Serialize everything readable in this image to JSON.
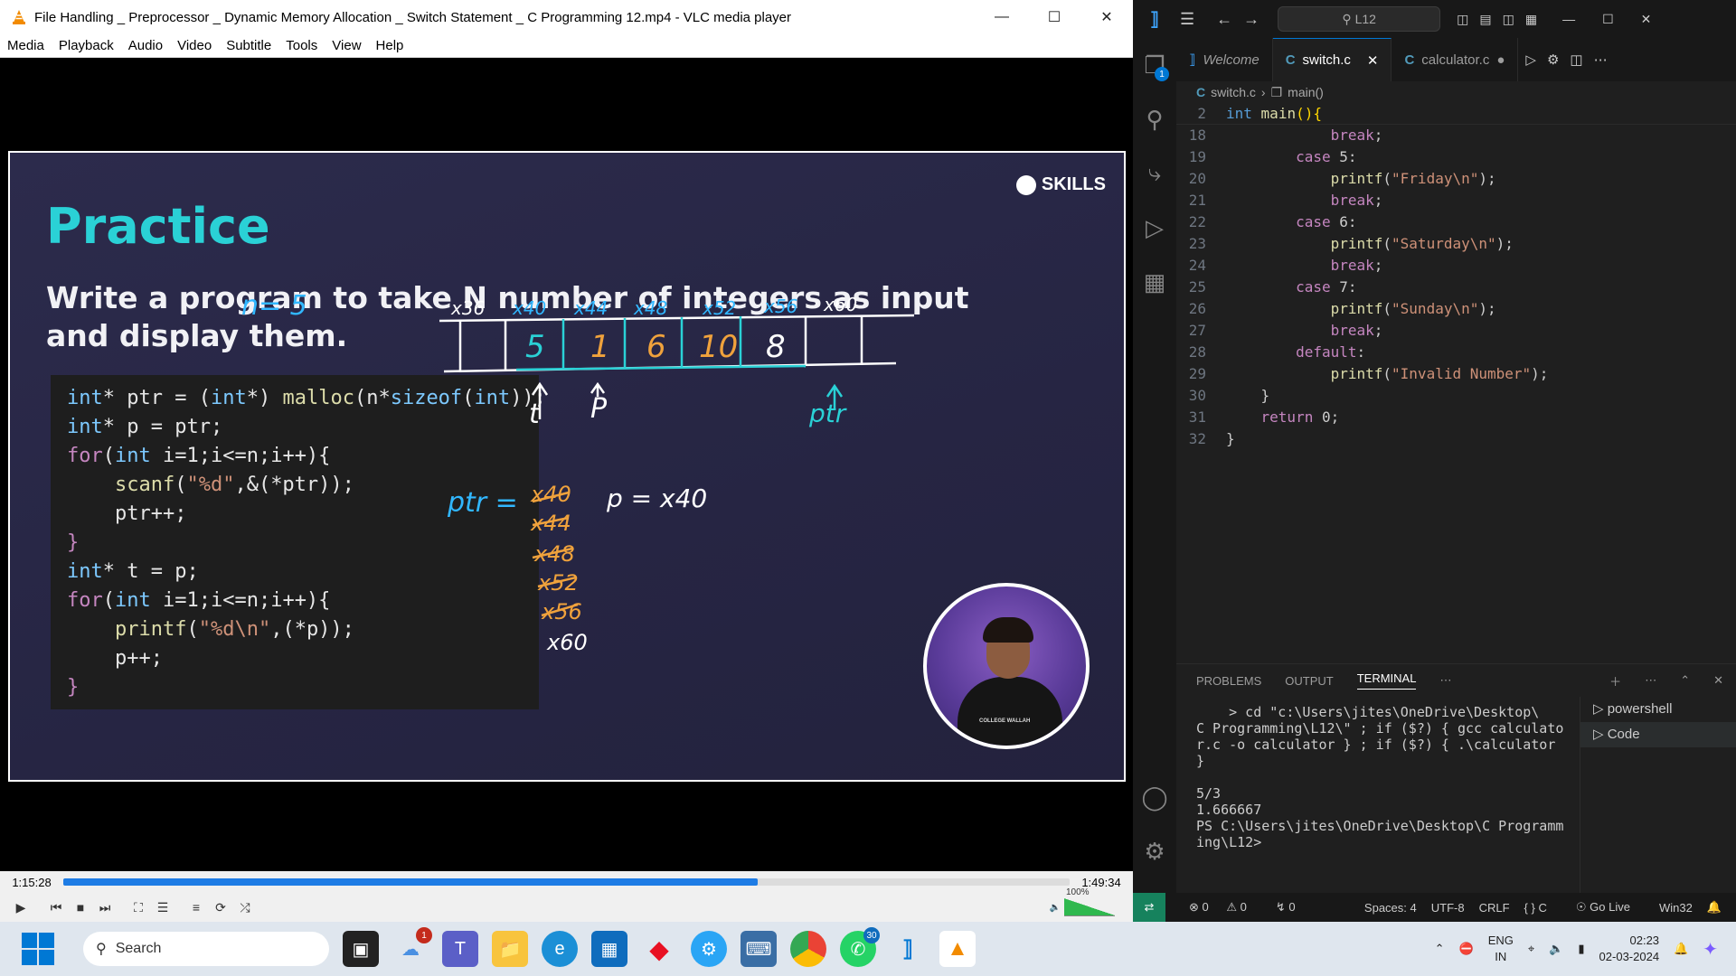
{
  "vlc": {
    "title": "File Handling _ Preprocessor _ Dynamic Memory Allocation _ Switch Statement _ C Programming 12.mp4 - VLC media player",
    "menu": [
      "Media",
      "Playback",
      "Audio",
      "Video",
      "Subtitle",
      "Tools",
      "View",
      "Help"
    ],
    "time_elapsed": "1:15:28",
    "time_total": "1:49:34",
    "progress_fraction": 0.69,
    "volume": "100%"
  },
  "slide": {
    "brand": "SKILLS",
    "heading": "Practice",
    "question": "Write a program to take N number of integers as input and display them.",
    "code": [
      "int* ptr = (int*) malloc(n*sizeof(int));",
      "int* p = ptr;",
      "for(int i=1;i<=n;i++){",
      "    scanf(\"%d\",&(*ptr));",
      "    ptr++;",
      "}",
      "int* t = p;",
      "for(int i=1;i<=n;i++){",
      "    printf(\"%d\\n\",(*p));",
      "    p++;",
      "}"
    ],
    "handwriting": {
      "n_equals": "n= 5",
      "addresses": [
        "x36",
        "x40",
        "x44",
        "x48",
        "x52",
        "x56",
        "x60"
      ],
      "cells": [
        "5",
        "1",
        "6",
        "10",
        "8"
      ],
      "arrow_t": "t",
      "arrow_p": "P",
      "arrow_ptr": "ptr",
      "ptr_label": "ptr =",
      "ptr_history": [
        "x40",
        "x44",
        "x48",
        "x52",
        "x56",
        "x60"
      ],
      "p_equals": "p = x40"
    },
    "presenter_badge": "COLLEGE WALLAH"
  },
  "vscode": {
    "search": "L12",
    "tabs": [
      {
        "label": "Welcome",
        "icon": "vscode-icon"
      },
      {
        "label": "switch.c",
        "icon": "c-icon"
      },
      {
        "label": "calculator.c",
        "icon": "c-icon"
      }
    ],
    "explorer_badge": "1",
    "breadcrumb": {
      "file": "switch.c",
      "symbol": "main()"
    },
    "sticky_line": {
      "num": "2",
      "text": "int main(){"
    },
    "lines": [
      {
        "num": "18",
        "text": "            break;"
      },
      {
        "num": "19",
        "text": "        case 5:"
      },
      {
        "num": "20",
        "text": "            printf(\"Friday\\n\");"
      },
      {
        "num": "21",
        "text": "            break;"
      },
      {
        "num": "22",
        "text": "        case 6:"
      },
      {
        "num": "23",
        "text": "            printf(\"Saturday\\n\");"
      },
      {
        "num": "24",
        "text": "            break;"
      },
      {
        "num": "25",
        "text": "        case 7:"
      },
      {
        "num": "26",
        "text": "            printf(\"Sunday\\n\");"
      },
      {
        "num": "27",
        "text": "            break;"
      },
      {
        "num": "28",
        "text": "        default:"
      },
      {
        "num": "29",
        "text": "            printf(\"Invalid Number\");"
      },
      {
        "num": "30",
        "text": "    }"
      },
      {
        "num": "31",
        "text": "    return 0;"
      },
      {
        "num": "32",
        "text": "}"
      }
    ],
    "panel_tabs": [
      "PROBLEMS",
      "OUTPUT",
      "TERMINAL"
    ],
    "terminal_lines": [
      "    > cd \"c:\\Users\\jites\\OneDrive\\Desktop\\",
      "C Programming\\L12\\\" ; if ($?) { gcc calculato",
      "r.c -o calculator } ; if ($?) { .\\calculator",
      "}",
      "",
      "5/3",
      "1.666667",
      "PS C:\\Users\\jites\\OneDrive\\Desktop\\C Programm",
      "ing\\L12> "
    ],
    "terminals": [
      "powershell",
      "Code"
    ],
    "status": {
      "errors": "0",
      "warnings": "0",
      "ports": "0",
      "spaces": "Spaces: 4",
      "encoding": "UTF-8",
      "eol": "CRLF",
      "language": "C",
      "golive": "Go Live",
      "platform": "Win32"
    }
  },
  "taskbar": {
    "search": "Search",
    "mail_badge": "1",
    "whatsapp_badge": "30",
    "lang": "ENG",
    "region": "IN",
    "time": "02:23",
    "date": "02-03-2024"
  },
  "colors": {
    "accent_teal": "#2ad1d6",
    "slide_bg": "#272645",
    "vlc_progress": "#1e7ce5",
    "vscode_accent": "#0078d4"
  }
}
